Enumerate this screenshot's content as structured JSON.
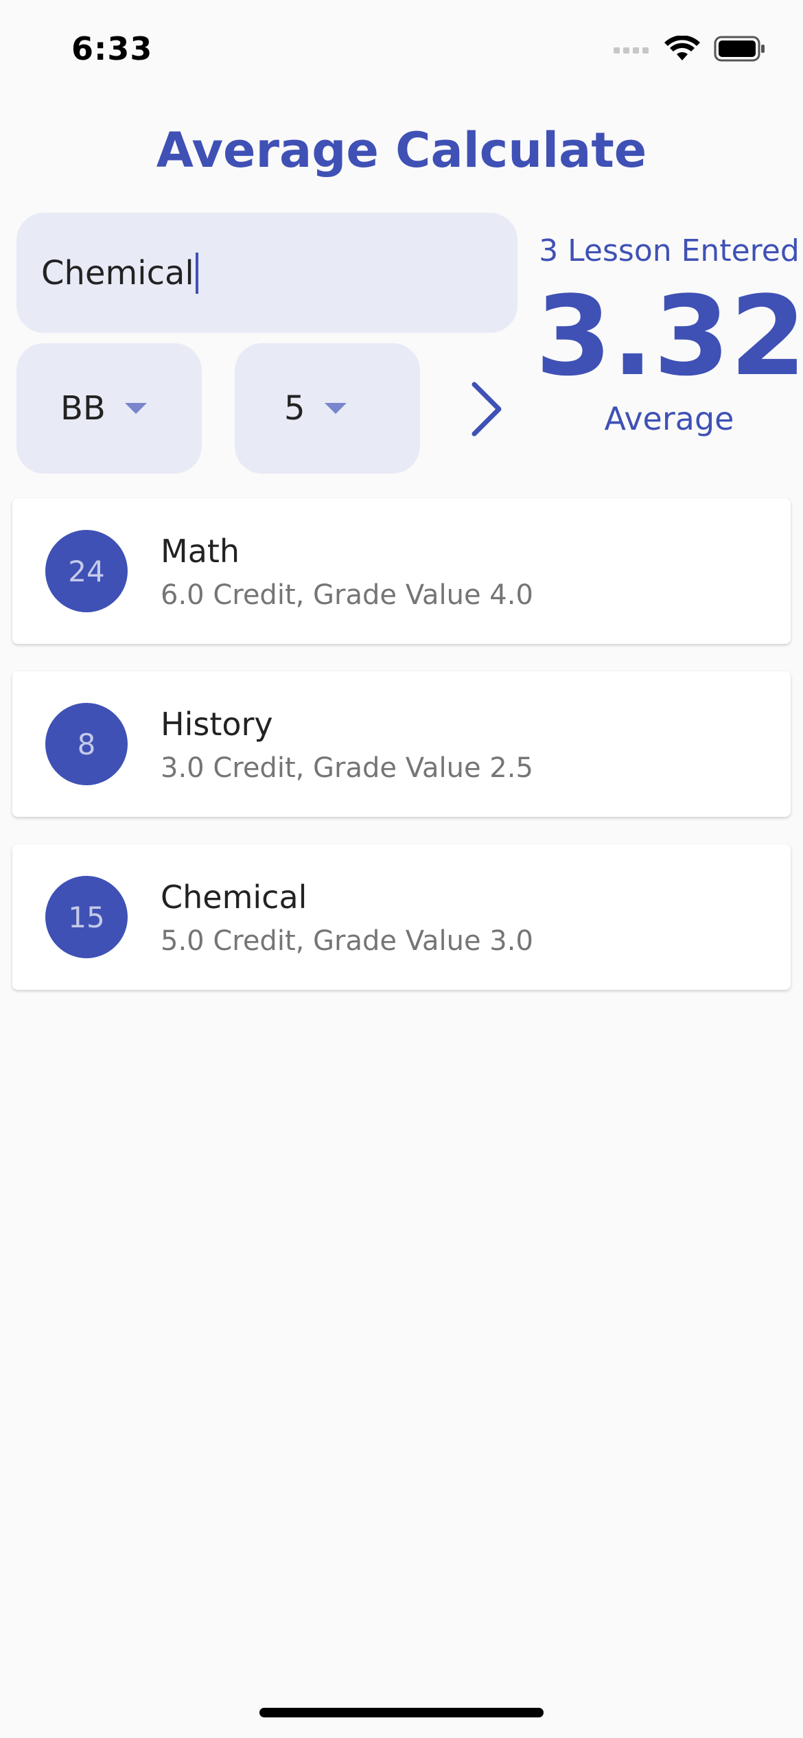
{
  "status_bar": {
    "time": "6:33"
  },
  "app": {
    "title": "Average Calculate"
  },
  "form": {
    "lesson_name_value": "Chemical",
    "grade_selected": "BB",
    "credit_selected": "5"
  },
  "summary": {
    "lesson_count_text": "3 Lesson Entered",
    "average_value": "3.32",
    "average_label": "Average"
  },
  "lessons": [
    {
      "badge": "24",
      "name": "Math",
      "details": "6.0 Credit, Grade Value 4.0"
    },
    {
      "badge": "8",
      "name": "History",
      "details": "3.0 Credit, Grade Value 2.5"
    },
    {
      "badge": "15",
      "name": "Chemical",
      "details": "5.0 Credit, Grade Value 3.0"
    }
  ],
  "colors": {
    "primary": "#3f51b5",
    "input_fill": "#e8eaf6",
    "background": "#fafafa",
    "secondary_text": "#757575"
  }
}
